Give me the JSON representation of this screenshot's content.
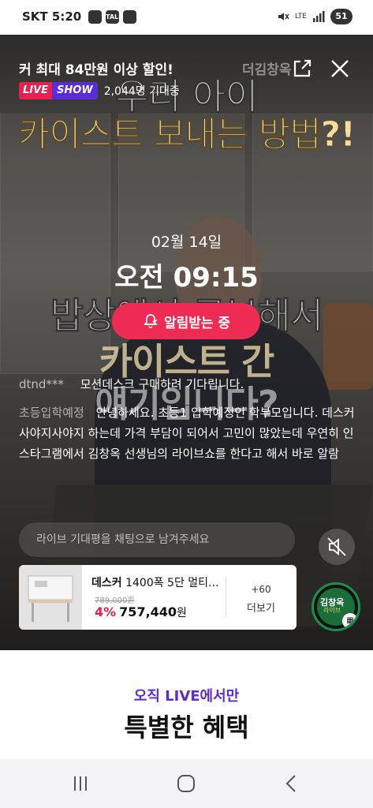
{
  "status_bar": {
    "carrier": "SKT 5:20",
    "icon_labels": [
      "",
      "TALK",
      ""
    ],
    "network": "LTE",
    "battery": "51"
  },
  "video_overlay": {
    "line1": "우리 아이",
    "line2": "카이스트 보내는 방법?!",
    "line3": "밥상에서 공부해서",
    "line4": "카이스트 간",
    "line5": "얘기입니다?"
  },
  "header": {
    "promo_banner": "커  최대 84만원 이상 할인!",
    "faded_label": "더김창옥",
    "live_label": "LIVE",
    "show_label": "SHOW",
    "viewer_count": "2,044명 기대중"
  },
  "schedule": {
    "date": "02월 14일",
    "time": "오전 09:15"
  },
  "alarm_button": {
    "label": "알림받는 중"
  },
  "chat": {
    "messages": [
      {
        "user": "dtnd***",
        "text": "모션데스크 구매하려 기다립니다."
      },
      {
        "user": "초등입학예정",
        "text": "안녕하세요. 초등1 입학예정인 학부모입니다. 데스커 사야지사야지 하는데 가격 부담이 되어서 고민이 많았는데 우연히 인스타그램에서 김창옥 선생님의 라이브쇼를 한다고 해서 바로 알람"
      }
    ],
    "input_placeholder": "라이브 기대평을 채팅으로 남겨주세요"
  },
  "product": {
    "brand": "데스커",
    "name": "1400폭 5단 멀티...",
    "original_price": "789,000원",
    "discount": "4%",
    "price": "757,440",
    "currency": "원",
    "more_count": "+60",
    "more_label": "더보기"
  },
  "host": {
    "name": "김창옥",
    "sub": "라이브"
  },
  "promo": {
    "subtitle": "오직 LIVE에서만",
    "title": "특별한 혜택"
  },
  "colors": {
    "live_red": "#e8204f",
    "show_purple": "#5a2bd8",
    "alarm_pink": "#ee2b53",
    "promo_purple": "#5c2bd2"
  }
}
